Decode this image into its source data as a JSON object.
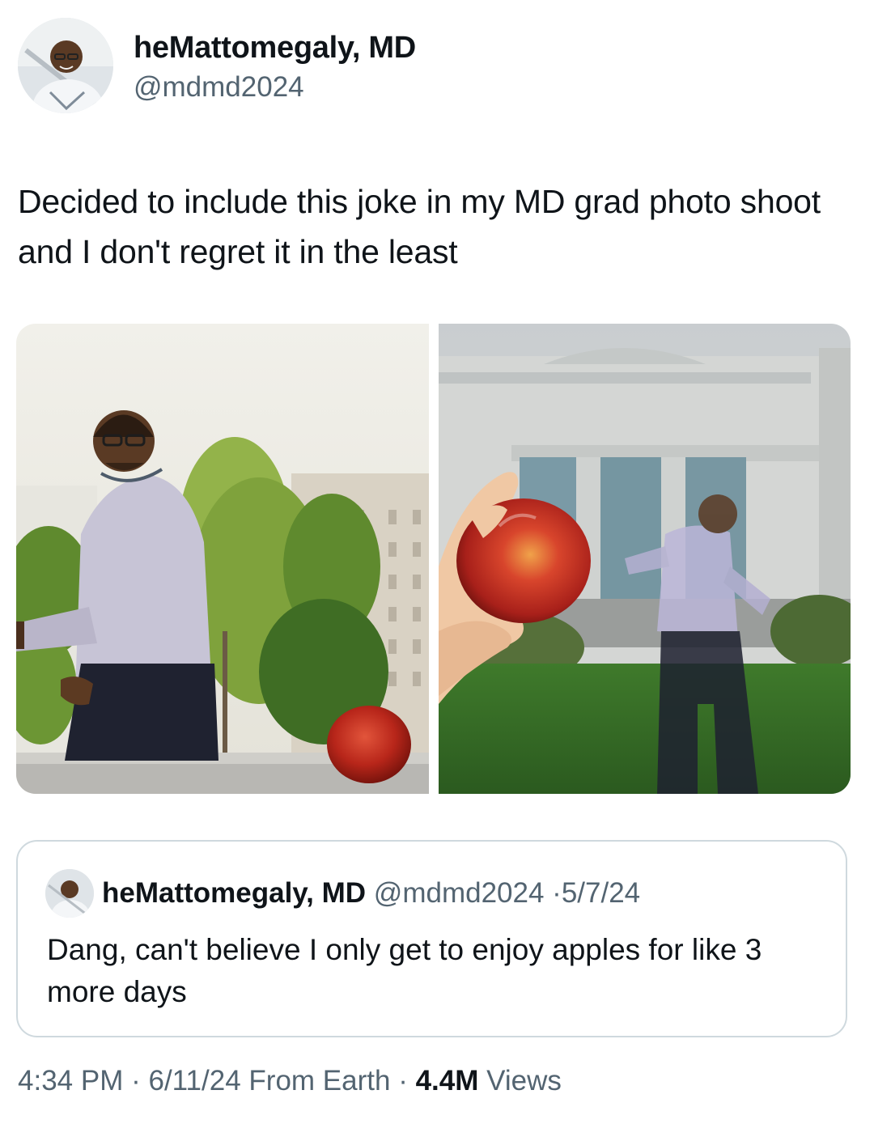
{
  "author": {
    "display_name": "heMattomegaly, MD",
    "handle": "@mdmd2024",
    "avatar_icon": "user-avatar-icon"
  },
  "tweet": {
    "text": "Decided to include this joke in my MD grad photo shoot and I don't regret it in the least"
  },
  "media": {
    "photo_count": 2
  },
  "quote": {
    "display_name": "heMattomegaly, MD",
    "handle": "@mdmd2024",
    "separator": "·",
    "date": "5/7/24",
    "text": "Dang, can't believe I only get to enjoy apples for like 3 more days"
  },
  "meta": {
    "time": "4:34 PM",
    "separator": "·",
    "date": "6/11/24",
    "source": "From Earth",
    "views_count": "4.4M",
    "views_label": "Views"
  }
}
